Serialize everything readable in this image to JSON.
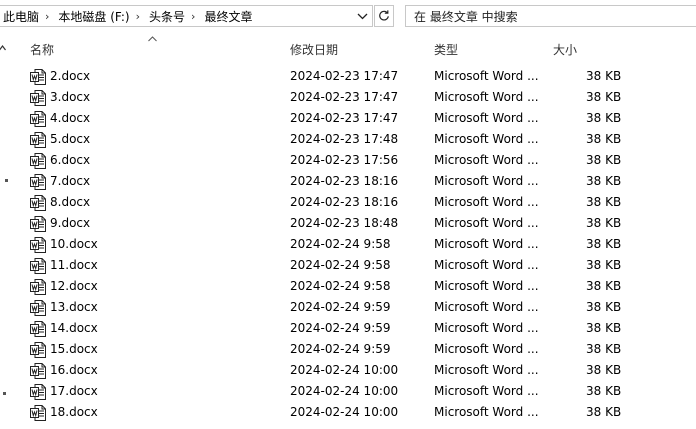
{
  "address_bar": {
    "breadcrumbs": [
      "此电脑",
      "本地磁盘 (F:)",
      "头条号",
      "最终文章"
    ]
  },
  "search": {
    "placeholder": "在 最终文章 中搜索"
  },
  "columns": {
    "name": "名称",
    "date": "修改日期",
    "type": "类型",
    "size": "大小"
  },
  "files": [
    {
      "name": "2.docx",
      "date": "2024-02-23 17:47",
      "type": "Microsoft Word ...",
      "size": "38 KB"
    },
    {
      "name": "3.docx",
      "date": "2024-02-23 17:47",
      "type": "Microsoft Word ...",
      "size": "38 KB"
    },
    {
      "name": "4.docx",
      "date": "2024-02-23 17:47",
      "type": "Microsoft Word ...",
      "size": "38 KB"
    },
    {
      "name": "5.docx",
      "date": "2024-02-23 17:48",
      "type": "Microsoft Word ...",
      "size": "38 KB"
    },
    {
      "name": "6.docx",
      "date": "2024-02-23 17:56",
      "type": "Microsoft Word ...",
      "size": "38 KB"
    },
    {
      "name": "7.docx",
      "date": "2024-02-23 18:16",
      "type": "Microsoft Word ...",
      "size": "38 KB"
    },
    {
      "name": "8.docx",
      "date": "2024-02-23 18:16",
      "type": "Microsoft Word ...",
      "size": "38 KB"
    },
    {
      "name": "9.docx",
      "date": "2024-02-23 18:48",
      "type": "Microsoft Word ...",
      "size": "38 KB"
    },
    {
      "name": "10.docx",
      "date": "2024-02-24 9:58",
      "type": "Microsoft Word ...",
      "size": "38 KB"
    },
    {
      "name": "11.docx",
      "date": "2024-02-24 9:58",
      "type": "Microsoft Word ...",
      "size": "38 KB"
    },
    {
      "name": "12.docx",
      "date": "2024-02-24 9:58",
      "type": "Microsoft Word ...",
      "size": "38 KB"
    },
    {
      "name": "13.docx",
      "date": "2024-02-24 9:59",
      "type": "Microsoft Word ...",
      "size": "38 KB"
    },
    {
      "name": "14.docx",
      "date": "2024-02-24 9:59",
      "type": "Microsoft Word ...",
      "size": "38 KB"
    },
    {
      "name": "15.docx",
      "date": "2024-02-24 9:59",
      "type": "Microsoft Word ...",
      "size": "38 KB"
    },
    {
      "name": "16.docx",
      "date": "2024-02-24 10:00",
      "type": "Microsoft Word ...",
      "size": "38 KB"
    },
    {
      "name": "17.docx",
      "date": "2024-02-24 10:00",
      "type": "Microsoft Word ...",
      "size": "38 KB"
    },
    {
      "name": "18.docx",
      "date": "2024-02-24 10:00",
      "type": "Microsoft Word ...",
      "size": "38 KB"
    }
  ],
  "icons": {
    "file": "word-document-icon",
    "dropdown": "chevron-down-icon",
    "refresh": "refresh-icon",
    "collapse": "chevron-up-icon",
    "sort": "sort-ascending-icon"
  }
}
